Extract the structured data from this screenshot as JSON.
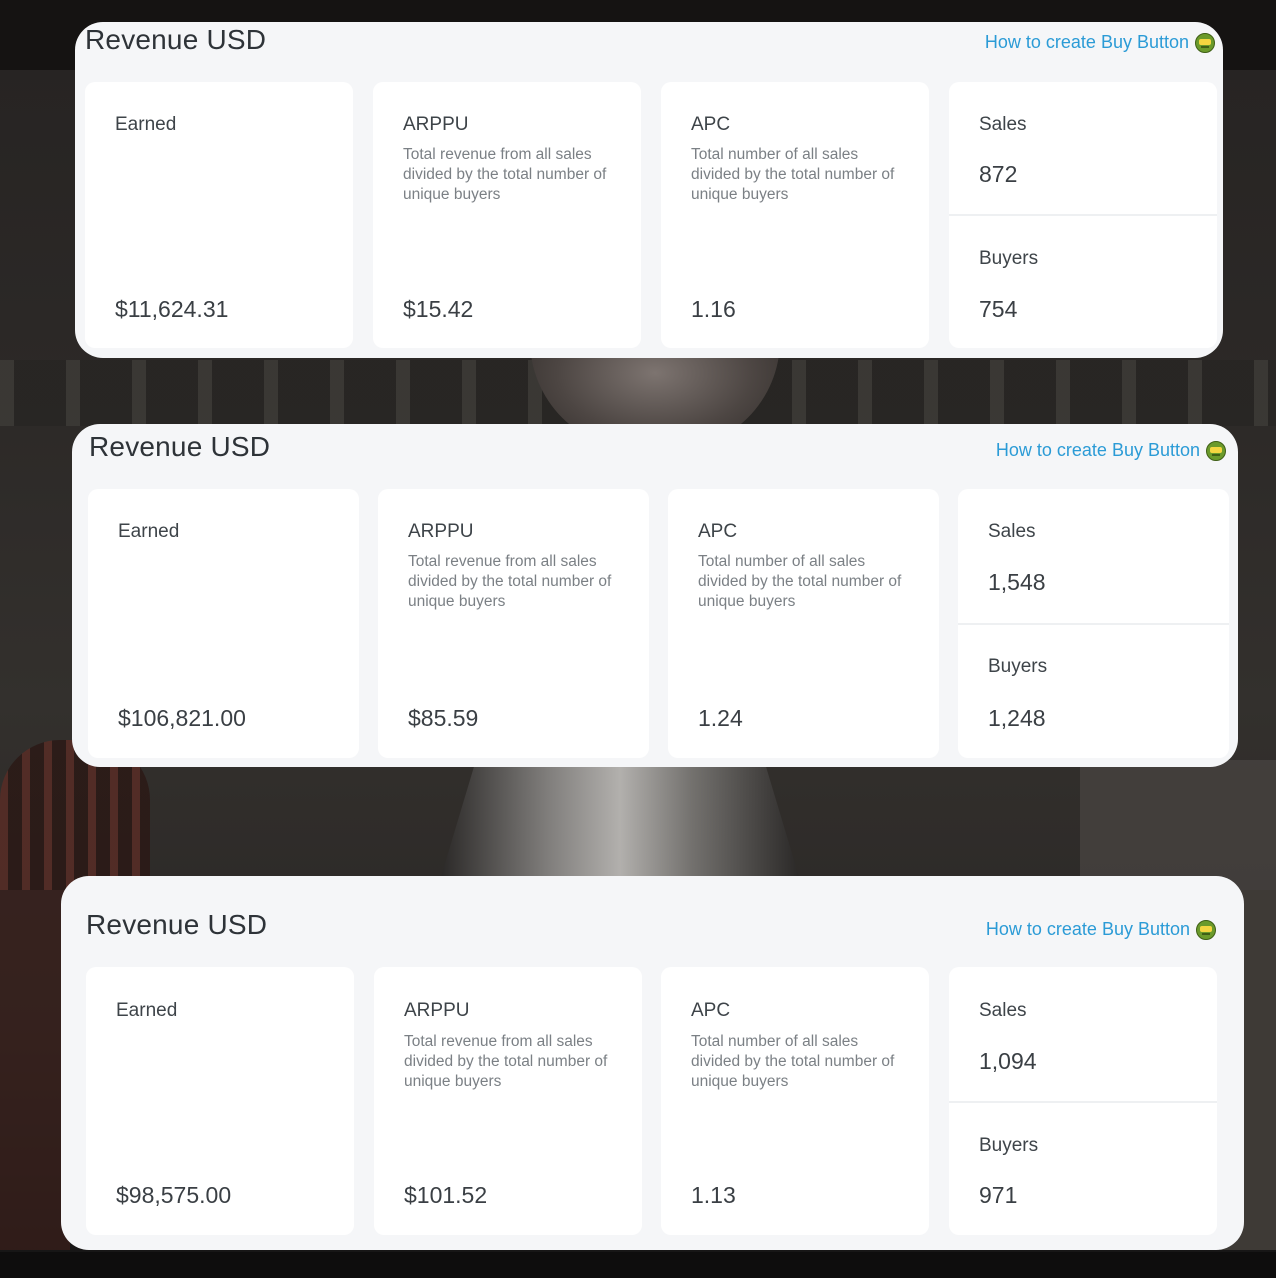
{
  "panels": [
    {
      "title": "Revenue USD",
      "help_link": "How to create Buy Button",
      "earned": {
        "label": "Earned",
        "value": "$11,624.31"
      },
      "arppu": {
        "label": "ARPPU",
        "description": "Total revenue from all sales divided by the total number of unique buyers",
        "value": "$15.42"
      },
      "apc": {
        "label": "APC",
        "description": "Total number of all sales divided by the total number of unique buyers",
        "value": "1.16"
      },
      "sales": {
        "label": "Sales",
        "value": "872"
      },
      "buyers": {
        "label": "Buyers",
        "value": "754"
      }
    },
    {
      "title": "Revenue USD",
      "help_link": "How to create Buy Button",
      "earned": {
        "label": "Earned",
        "value": "$106,821.00"
      },
      "arppu": {
        "label": "ARPPU",
        "description": "Total revenue from all sales divided by the total number of unique buyers",
        "value": "$85.59"
      },
      "apc": {
        "label": "APC",
        "description": "Total number of all sales divided by the total number of unique buyers",
        "value": "1.24"
      },
      "sales": {
        "label": "Sales",
        "value": "1,548"
      },
      "buyers": {
        "label": "Buyers",
        "value": "1,248"
      }
    },
    {
      "title": "Revenue USD",
      "help_link": "How to create Buy Button",
      "earned": {
        "label": "Earned",
        "value": "$98,575.00"
      },
      "arppu": {
        "label": "ARPPU",
        "description": "Total revenue from all sales divided by the total number of unique buyers",
        "value": "$101.52"
      },
      "apc": {
        "label": "APC",
        "description": "Total number of all sales divided by the total number of unique buyers",
        "value": "1.13"
      },
      "sales": {
        "label": "Sales",
        "value": "1,094"
      },
      "buyers": {
        "label": "Buyers",
        "value": "971"
      }
    }
  ],
  "colors": {
    "panel_bg": "#f5f6f8",
    "card_bg": "#ffffff",
    "link": "#2b9bd6",
    "text": "#3a3f44",
    "muted": "#7b8085"
  },
  "icons": {
    "help_link_icon": "robot-face-icon"
  }
}
